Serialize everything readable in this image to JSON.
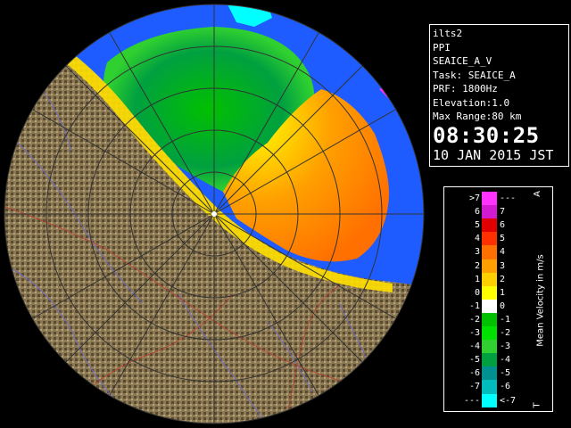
{
  "info": {
    "station": "ilts2",
    "scan_type": "PPI",
    "product": "SEAICE_A_V",
    "task": "Task: SEAICE_A",
    "prf": "PRF: 1800Hz",
    "elevation": "Elevation:1.0",
    "max_range": "Max Range:80 km",
    "time": "08:30:25",
    "date": "10 JAN 2015 JST"
  },
  "legend": {
    "title": "Mean Velocity in m/s",
    "corner_top": "A",
    "corner_bottom": "T",
    "rows": [
      {
        "left": ">7",
        "right": "---",
        "color": "#ff33ff"
      },
      {
        "left": "6",
        "right": "7",
        "color": "#d11bd1"
      },
      {
        "left": "5",
        "right": "6",
        "color": "#e00000"
      },
      {
        "left": "4",
        "right": "5",
        "color": "#ff3000"
      },
      {
        "left": "3",
        "right": "4",
        "color": "#ff7000"
      },
      {
        "left": "2",
        "right": "3",
        "color": "#ffa000"
      },
      {
        "left": "1",
        "right": "2",
        "color": "#ffcf00"
      },
      {
        "left": "0",
        "right": "1",
        "color": "#ffff00"
      },
      {
        "left": "-1",
        "right": "0",
        "color": "#ffffff"
      },
      {
        "left": "-2",
        "right": "-1",
        "color": "#00c000"
      },
      {
        "left": "-3",
        "right": "-2",
        "color": "#00e000"
      },
      {
        "left": "-4",
        "right": "-3",
        "color": "#30d030"
      },
      {
        "left": "-5",
        "right": "-4",
        "color": "#00a040"
      },
      {
        "left": "-6",
        "right": "-5",
        "color": "#009090"
      },
      {
        "left": "-7",
        "right": "-6",
        "color": "#00bcbc"
      },
      {
        "left": "---",
        "right": "<-7",
        "color": "#00ffff"
      }
    ]
  },
  "map": {
    "sea_color": "#1e5cff",
    "land_color": "#8c7a55",
    "offscan_color": "#000000"
  }
}
